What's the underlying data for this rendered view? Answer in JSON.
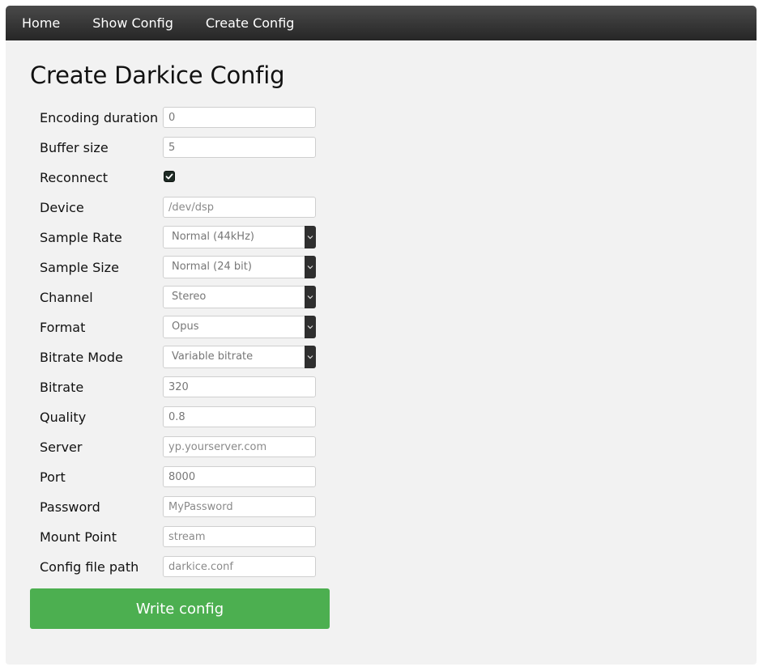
{
  "nav": {
    "items": [
      "Home",
      "Show Config",
      "Create Config"
    ]
  },
  "page": {
    "title": "Create Darkice Config"
  },
  "form": {
    "encoding_duration": {
      "label": "Encoding duration",
      "value": "0"
    },
    "buffer_size": {
      "label": "Buffer size",
      "value": "5"
    },
    "reconnect": {
      "label": "Reconnect",
      "checked": true
    },
    "device": {
      "label": "Device",
      "placeholder": "/dev/dsp"
    },
    "sample_rate": {
      "label": "Sample Rate",
      "selected": "Normal (44kHz)"
    },
    "sample_size": {
      "label": "Sample Size",
      "selected": "Normal (24 bit)"
    },
    "channel": {
      "label": "Channel",
      "selected": "Stereo"
    },
    "format": {
      "label": "Format",
      "selected": "Opus"
    },
    "bitrate_mode": {
      "label": "Bitrate Mode",
      "selected": "Variable bitrate"
    },
    "bitrate": {
      "label": "Bitrate",
      "value": "320"
    },
    "quality": {
      "label": "Quality",
      "value": "0.8"
    },
    "server": {
      "label": "Server",
      "placeholder": "yp.yourserver.com"
    },
    "port": {
      "label": "Port",
      "value": "8000"
    },
    "password": {
      "label": "Password",
      "placeholder": "MyPassword"
    },
    "mount_point": {
      "label": "Mount Point",
      "placeholder": "stream"
    },
    "config_file_path": {
      "label": "Config file path",
      "placeholder": "darkice.conf"
    }
  },
  "actions": {
    "write_label": "Write config"
  },
  "colors": {
    "navbar_top": "#4a4a4a",
    "navbar_bottom": "#262626",
    "panel_bg": "#f2f2f2",
    "button_green": "#4caf50",
    "checkbox_bg": "#1e2a24",
    "select_arrow_bg": "#2f2f2f"
  },
  "icons": {
    "checkbox": "checkmark-icon",
    "select_arrow": "chevron-down-icon"
  }
}
